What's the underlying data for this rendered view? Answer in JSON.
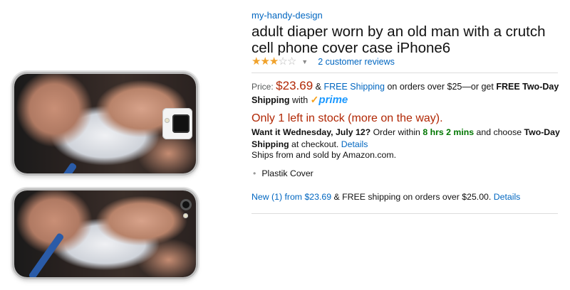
{
  "product": {
    "brand": "my-handy-design",
    "title": "adult diaper worn by an old man with a crutch cell phone cover case iPhone6",
    "rating": {
      "stars": 3,
      "max": 5,
      "reviews_label": "2 customer reviews"
    }
  },
  "pricing": {
    "price_label": "Price:",
    "price": "$23.69",
    "amp": "&",
    "free_shipping": "FREE Shipping",
    "shipping_rest": "on orders over $25—or get",
    "two_day": "FREE Two-Day Shipping",
    "with": "with",
    "prime_check": "✓",
    "prime_word": "prime"
  },
  "availability": {
    "stock": "Only 1 left in stock (more on the way).",
    "want_it": "Want it Wednesday, July 12?",
    "order_within": "Order within",
    "countdown": "8 hrs 2 mins",
    "choose": "and choose",
    "two_day_shipping": "Two-Day Shipping",
    "at_checkout": "at checkout.",
    "details": "Details",
    "ships_from": "Ships from and sold by Amazon.com."
  },
  "features": [
    "Plastik Cover"
  ],
  "offers": {
    "new_label": "New (1) from $23.69",
    "rest": "& FREE shipping on orders over $25.00.",
    "details": "Details"
  },
  "colors": {
    "price": "#b12704",
    "link": "#0066c0",
    "star": "#f0a22b",
    "prime_blue": "#1a98ff",
    "green": "#007600"
  }
}
